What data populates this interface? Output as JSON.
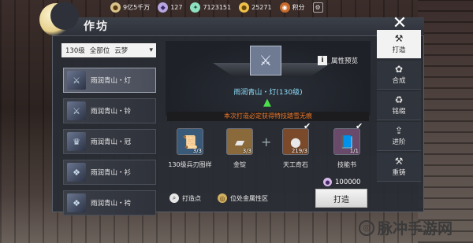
{
  "resources": [
    {
      "icon": "score-icon",
      "value": "9亿5千万"
    },
    {
      "icon": "gem-icon",
      "value": "127"
    },
    {
      "icon": "jade-icon",
      "value": "7123151"
    },
    {
      "icon": "coin-icon",
      "value": "25271"
    },
    {
      "icon": "points-icon",
      "value": "积分"
    }
  ],
  "panel": {
    "title": "作坊"
  },
  "filter": {
    "level": "130级",
    "slot": "全部位",
    "set": "云梦"
  },
  "list": [
    {
      "label": "雨润青山・灯",
      "selected": true
    },
    {
      "label": "雨润青山・铃",
      "selected": false
    },
    {
      "label": "雨润青山・冠",
      "selected": false
    },
    {
      "label": "雨润青山・衫",
      "selected": false
    },
    {
      "label": "雨润青山・袴",
      "selected": false
    }
  ],
  "preview": {
    "label": "属性预览"
  },
  "craft_item": {
    "name": "雨润青山・灯(130级)"
  },
  "notice": "本次打造必定获得特技踏雪无痕",
  "materials": [
    {
      "name": "130级兵刃图样",
      "count": "3/3",
      "checked": false
    },
    {
      "name": "金锭",
      "count": "3/3",
      "checked": false
    },
    {
      "name": "天工奇石",
      "count": "219/3",
      "checked": true
    },
    {
      "name": "技能书",
      "count": "1/1",
      "checked": true
    }
  ],
  "cost": {
    "value": "100000"
  },
  "buttons": {
    "craft": "打造",
    "craft_points": "打造点",
    "bonus": "位处金属性区"
  },
  "tabs": [
    {
      "label": "打造",
      "active": true
    },
    {
      "label": "合成",
      "active": false
    },
    {
      "label": "铭缀",
      "active": false
    },
    {
      "label": "进阶",
      "active": false
    },
    {
      "label": "重铸",
      "active": false
    }
  ],
  "watermark": "脉冲手游网"
}
